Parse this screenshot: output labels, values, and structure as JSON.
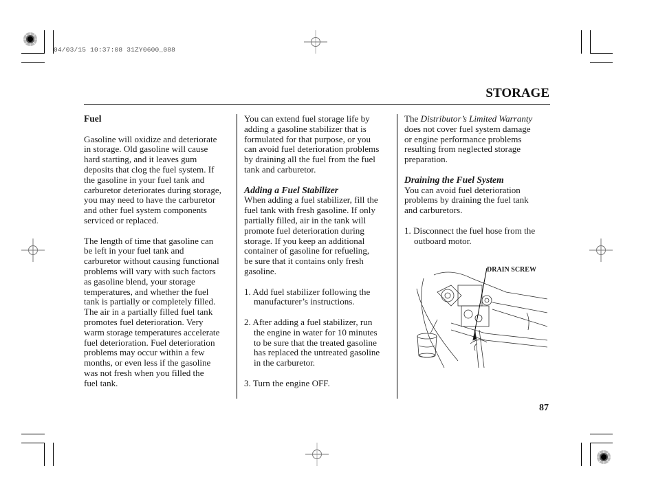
{
  "print_stamp": "04/03/15 10:37:08 31ZY0600_088",
  "section_title": "STORAGE",
  "page_number": "87",
  "column1": {
    "heading": "Fuel",
    "paragraph1": [
      "Gasoline will oxidize and deteriorate",
      "in storage. Old gasoline will cause",
      "hard starting, and it leaves gum",
      "deposits that clog the fuel system. If",
      "the gasoline in your fuel tank and",
      "carburetor deteriorates during storage,",
      "you may need to have the carburetor",
      "and other fuel system components",
      "serviced or replaced."
    ],
    "paragraph2": [
      "The length of time that gasoline can",
      "be left in your fuel tank and",
      "carburetor without causing functional",
      "problems will vary with such factors",
      "as gasoline blend, your storage",
      "temperatures, and whether the fuel",
      "tank is partially or completely filled.",
      "The air in a partially filled fuel tank",
      "promotes fuel deterioration. Very",
      "warm storage temperatures accelerate",
      "fuel deterioration. Fuel deterioration",
      "problems may occur within a few",
      "months, or even less if the gasoline",
      "was not fresh when you filled the",
      "fuel tank."
    ]
  },
  "column2": {
    "intro": [
      "You can extend fuel storage life by",
      "adding a gasoline stabilizer that is",
      "formulated for that purpose, or you",
      "can avoid fuel deterioration problems",
      "by draining all the fuel from the fuel",
      "tank and carburetor."
    ],
    "subheading": "Adding a Fuel Stabilizer",
    "body": [
      "When adding a fuel stabilizer, fill the",
      "fuel tank with fresh gasoline. If only",
      "partially filled, air in the tank will",
      "promote fuel deterioration during",
      "storage. If you keep an additional",
      "container of gasoline for refueling,",
      "be sure that it contains only fresh",
      "gasoline."
    ],
    "steps": [
      [
        "1. Add fuel stabilizer following the",
        "manufacturer’s instructions."
      ],
      [
        "2. After adding a fuel stabilizer, run",
        "the engine in water for 10 minutes",
        "to be sure that the treated gasoline",
        "has replaced the untreated gasoline",
        "in the carburetor."
      ],
      [
        "3. Turn the engine OFF."
      ]
    ]
  },
  "column3": {
    "warranty_prefix": "The ",
    "warranty_italic": "Distributor’s Limited Warranty",
    "warranty_rest": [
      "does not cover fuel system damage",
      "or engine performance problems",
      "resulting from neglected storage",
      "preparation."
    ],
    "subheading": "Draining the Fuel System",
    "body": [
      "You can avoid fuel deterioration",
      "problems by draining the fuel tank",
      "and carburetors."
    ],
    "steps": [
      [
        "1. Disconnect the fuel hose from the",
        "outboard motor."
      ]
    ],
    "figure_label": "DRAIN SCREW"
  }
}
